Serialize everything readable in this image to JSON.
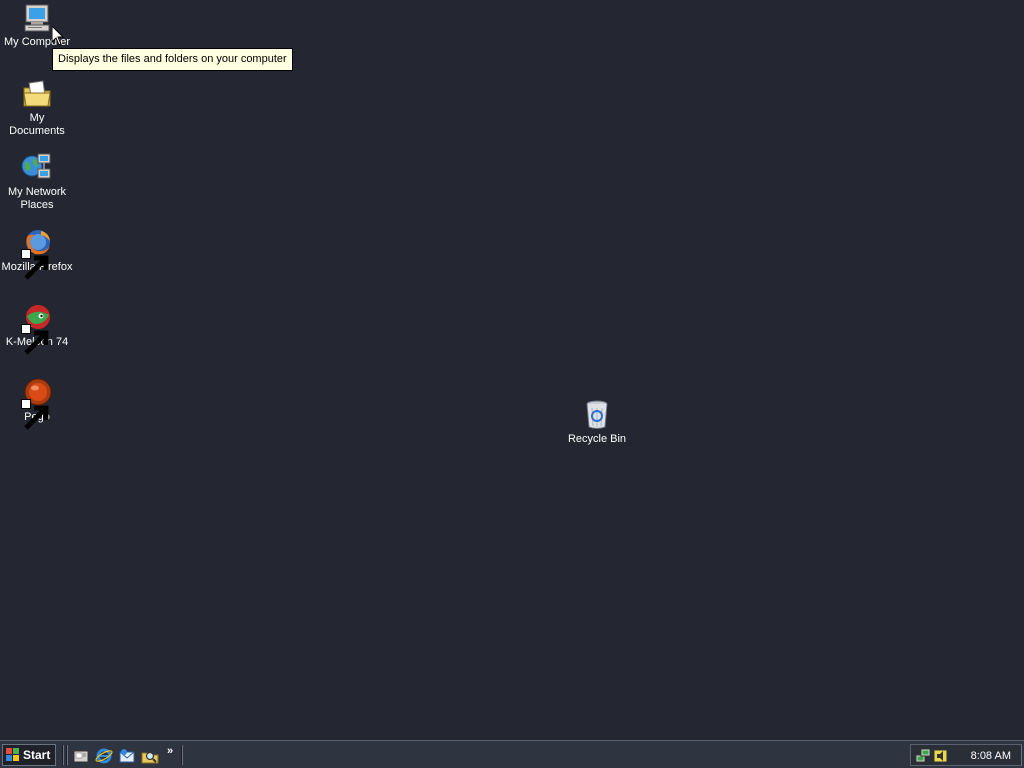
{
  "desktop": {
    "background_color": "#242731",
    "icons": [
      {
        "label": "My Computer",
        "icon": "my-computer-icon"
      },
      {
        "label": "My Documents",
        "icon": "my-documents-icon"
      },
      {
        "label": "My Network Places",
        "icon": "network-places-icon"
      },
      {
        "label": "Mozilla Firefox",
        "icon": "firefox-icon"
      },
      {
        "label": "K-Meleon 74",
        "icon": "k-meleon-icon"
      },
      {
        "label": "Pego",
        "icon": "pego-icon"
      },
      {
        "label": "Recycle Bin",
        "icon": "recycle-bin-icon"
      }
    ]
  },
  "tooltip": {
    "text": "Displays the files and folders on your computer"
  },
  "taskbar": {
    "start_label": "Start",
    "quick_launch": [
      "show-desktop-icon",
      "internet-explorer-icon",
      "outlook-express-icon",
      "search-icon"
    ],
    "overflow_label": "»",
    "tray_icons": [
      "network-tray-icon",
      "volume-tray-icon"
    ],
    "clock": "8:08 AM"
  }
}
